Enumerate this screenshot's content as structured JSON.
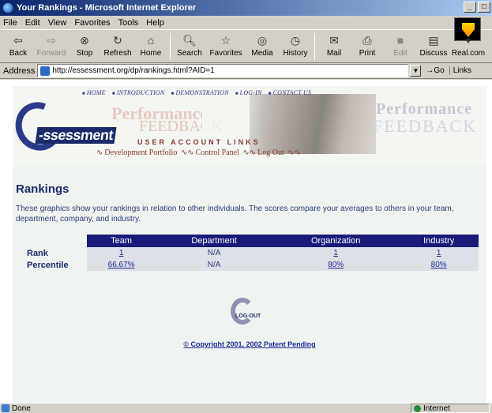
{
  "window": {
    "title": "Your Rankings - Microsoft Internet Explorer"
  },
  "menu": [
    "File",
    "Edit",
    "View",
    "Favorites",
    "Tools",
    "Help"
  ],
  "toolbar": {
    "back": "Back",
    "forward": "Forward",
    "stop": "Stop",
    "refresh": "Refresh",
    "home": "Home",
    "search": "Search",
    "favorites": "Favorites",
    "media": "Media",
    "history": "History",
    "mail": "Mail",
    "print": "Print",
    "edit": "Edit",
    "discuss": "Discuss",
    "realcom": "Real.com"
  },
  "address": {
    "label": "Address",
    "url": "http://essessment.org/dp/rankings.html?AID=1",
    "go": "Go",
    "links": "Links"
  },
  "banner": {
    "nav": [
      "HOME",
      "INTRODUCTION",
      "DEMONSTRATION",
      "LOG-IN",
      "CONTACT US"
    ],
    "logo_text": "-ssessment",
    "ghost_performance": "Performance",
    "ghost_feedback": "FEEDBACK",
    "user_account_links": "USER ACCOUNT LINKS",
    "sublinks": [
      "Development Portfolio",
      "Control Panel",
      "Log Out"
    ]
  },
  "page": {
    "heading": "Rankings",
    "description": "These graphics show your rankings in relation to other individuals.  The scores compare your averages to others in your team, department, company, and industry."
  },
  "rankings": {
    "columns": [
      "Team",
      "Department",
      "Organization",
      "Industry"
    ],
    "rows": [
      {
        "label": "Rank",
        "values": [
          "1",
          "N/A",
          "1",
          "1"
        ]
      },
      {
        "label": "Percentile",
        "values": [
          "66.67%",
          "N/A",
          "80%",
          "80%"
        ]
      }
    ]
  },
  "logout_label": "LOG-OUT",
  "copyright": "© Copyright 2001, 2002 Patent Pending",
  "status": {
    "text": "Done",
    "zone": "Internet"
  }
}
